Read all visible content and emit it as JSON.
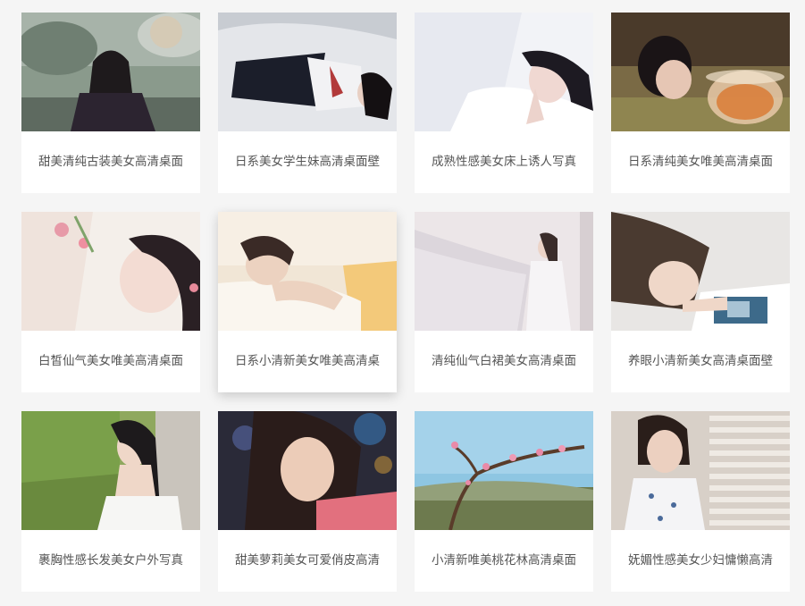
{
  "gallery": {
    "items": [
      {
        "title": "甜美清纯古装美女高清桌面",
        "image": "woman-hanfu-fan-photo"
      },
      {
        "title": "日系美女学生妹高清桌面壁",
        "image": "woman-school-uniform-photo"
      },
      {
        "title": "成熟性感美女床上诱人写真",
        "image": "woman-lying-white-bed-photo"
      },
      {
        "title": "日系清纯美女唯美高清桌面",
        "image": "woman-goldfish-bowl-photo"
      },
      {
        "title": "白皙仙气美女唯美高清桌面",
        "image": "woman-pink-flowers-photo"
      },
      {
        "title": "日系小清新美女唯美高清桌",
        "image": "woman-sleeping-warm-light-photo"
      },
      {
        "title": "清纯仙气白裙美女高清桌面",
        "image": "woman-white-dress-curtain-photo"
      },
      {
        "title": "养眼小清新美女高清桌面壁",
        "image": "woman-reading-magazine-photo"
      },
      {
        "title": "裹胸性感长发美女户外写真",
        "image": "woman-outdoor-grass-photo"
      },
      {
        "title": "甜美萝莉美女可爱俏皮高清",
        "image": "woman-pink-top-bokeh-photo"
      },
      {
        "title": "小清新唯美桃花林高清桌面",
        "image": "peach-blossom-branch-photo"
      },
      {
        "title": "妩媚性感美女少妇慵懒高清",
        "image": "woman-window-blinds-photo"
      }
    ]
  }
}
